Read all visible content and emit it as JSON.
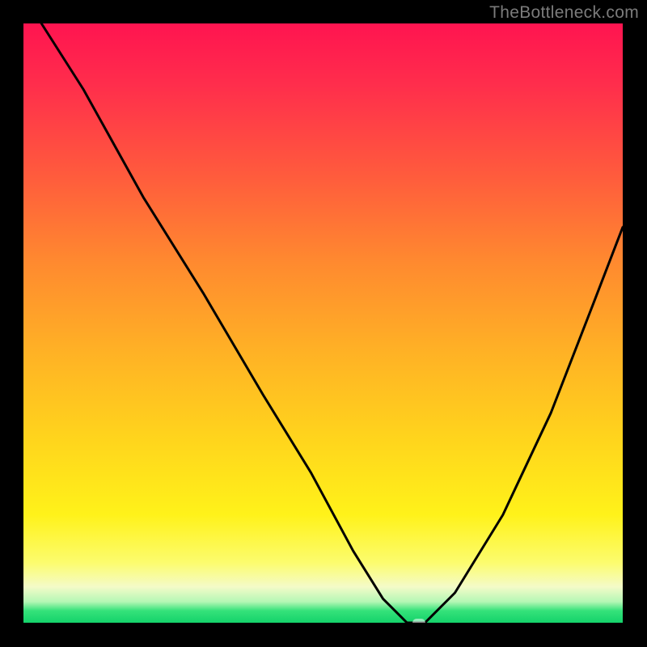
{
  "credit_text": "TheBottleneck.com",
  "chart_data": {
    "type": "line",
    "title": "",
    "xlabel": "",
    "ylabel": "",
    "xlim": [
      0,
      100
    ],
    "ylim": [
      0,
      100
    ],
    "grid": false,
    "series": [
      {
        "name": "bottleneck-curve",
        "x": [
          3,
          10,
          20,
          30,
          40,
          48,
          55,
          60,
          64,
          67,
          72,
          80,
          88,
          95,
          100
        ],
        "values": [
          100,
          89,
          71,
          55,
          38,
          25,
          12,
          4,
          0,
          0,
          5,
          18,
          35,
          53,
          66
        ]
      }
    ],
    "marker": {
      "x": 66,
      "y": 0
    }
  },
  "colors": {
    "curve_stroke": "#000000",
    "marker_bg": "rgba(255,255,255,0.55)",
    "frame_bg": "#000000"
  }
}
